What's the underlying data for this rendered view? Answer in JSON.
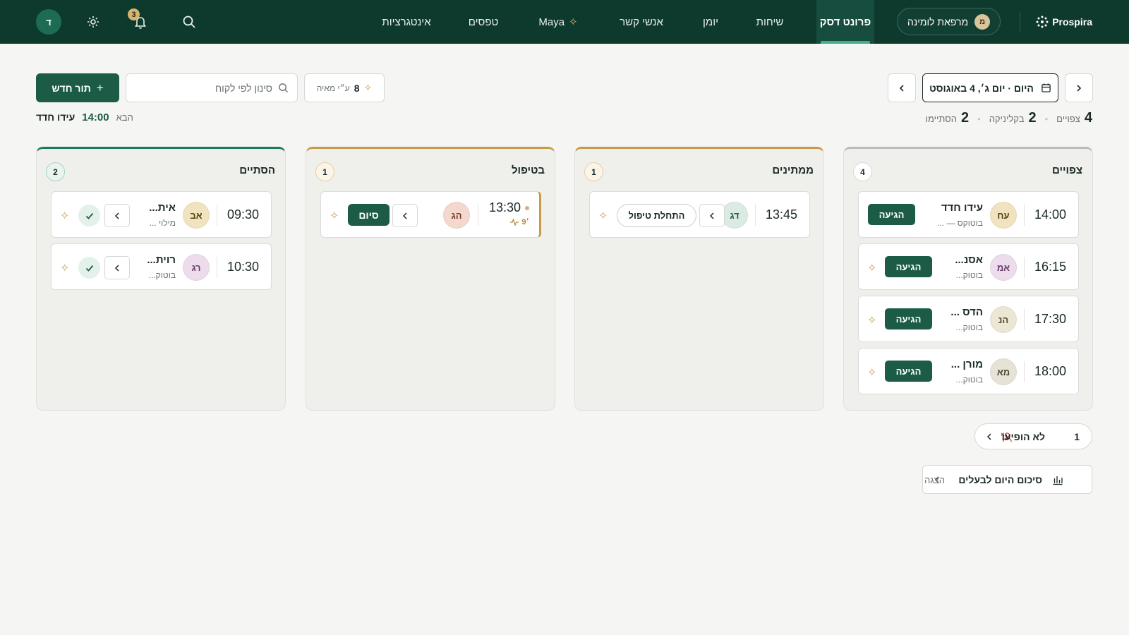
{
  "nav": {
    "brand": "Prospira",
    "clinic": {
      "name": "מרפאת לומינה",
      "initial": "מ"
    },
    "tabs": [
      {
        "label": "פרונט דסק",
        "active": true
      },
      {
        "label": "שיחות"
      },
      {
        "label": "יומן"
      },
      {
        "label": "אנשי קשר"
      },
      {
        "label": "Maya"
      },
      {
        "label": "טפסים"
      },
      {
        "label": "אינטגרציות"
      }
    ],
    "notification_count": "3",
    "user_initial": "ד"
  },
  "toolbar": {
    "date_label": "היום · יום ג׳, 4 באוגוסט",
    "new_appointment": "תור חדש",
    "search_placeholder": "סינון לפי לקוח",
    "maya_count": "8",
    "maya_label": "ע״י מאיה"
  },
  "stats": {
    "expected_count": "4",
    "expected_label": "צפויים",
    "in_clinic_count": "2",
    "in_clinic_label": "בקליניקה",
    "done_count": "2",
    "done_label": "הסתיימו"
  },
  "next": {
    "label": "הבא",
    "time": "14:00",
    "name": "עידו חדד"
  },
  "columns": {
    "expected": {
      "title": "צפויים",
      "count": "4",
      "cards": [
        {
          "time": "14:00",
          "initials": "עח",
          "name": "עידו חדד",
          "sub": "בוטוקס — ...",
          "action": "הגיעה"
        },
        {
          "time": "16:15",
          "initials": "אמ",
          "name": "אסנ...",
          "sub": "בוטוק...",
          "action": "הגיעה"
        },
        {
          "time": "17:30",
          "initials": "הנ",
          "name": "הדס ...",
          "sub": "בוטוק...",
          "action": "הגיעה"
        },
        {
          "time": "18:00",
          "initials": "מא",
          "name": "מורן ...",
          "sub": "בוטוק...",
          "action": "הגיעה"
        }
      ]
    },
    "waiting": {
      "title": "ממתינים",
      "count": "1",
      "cards": [
        {
          "time": "13:45",
          "initials": "דג",
          "action": "התחלת טיפול"
        }
      ]
    },
    "in_treatment": {
      "title": "בטיפול",
      "count": "1",
      "cards": [
        {
          "time": "13:30",
          "initials": "הג",
          "elapsed": "9׳",
          "action": "סיום"
        }
      ]
    },
    "done": {
      "title": "הסתיים",
      "count": "2",
      "cards": [
        {
          "time": "09:30",
          "initials": "אב",
          "name": "אית...",
          "sub": "מילוי ..."
        },
        {
          "time": "10:30",
          "initials": "רג",
          "name": "רוית...",
          "sub": "בוטוק..."
        }
      ]
    }
  },
  "noshow": {
    "label": "לא הופיעו",
    "count": "1"
  },
  "summary": {
    "label": "סיכום היום לבעלים",
    "action": "הצגה"
  },
  "colors": {
    "nav_bg": "#0e3a2e",
    "primary": "#1c5c47",
    "accent_gold": "#c59a4a",
    "active_underline": "#43b08a"
  }
}
